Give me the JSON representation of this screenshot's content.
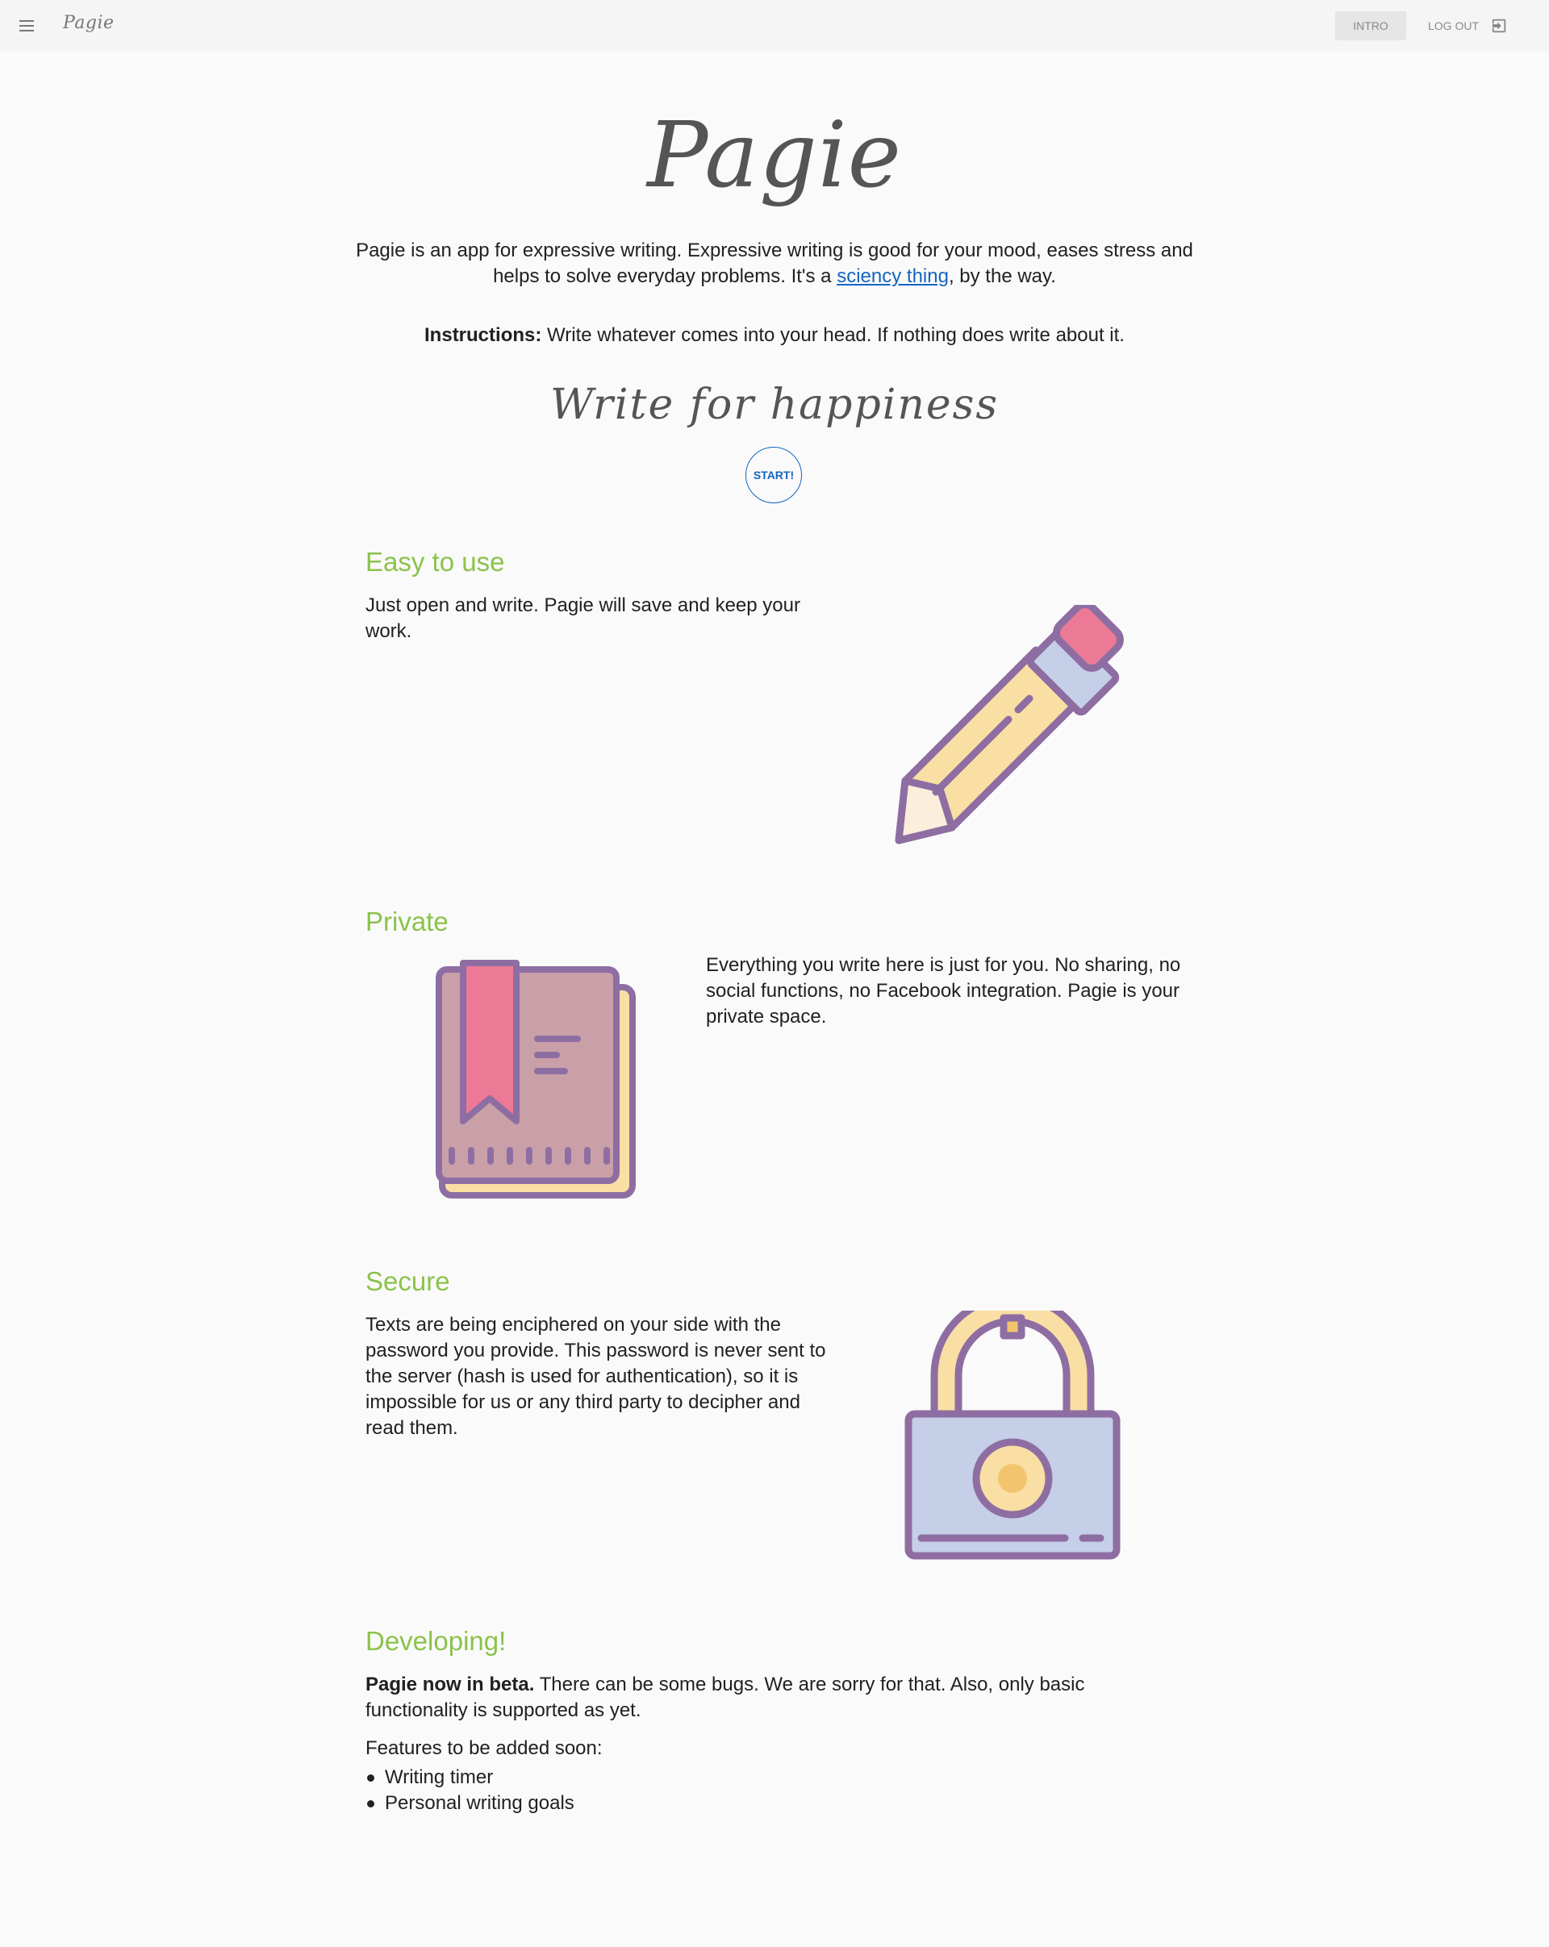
{
  "header": {
    "logo": "Pagie",
    "tabs": [
      {
        "label": "INTRO"
      }
    ],
    "logout_label": "LOG OUT"
  },
  "hero": {
    "logo": "Pagie",
    "intro_before_link": "Pagie is an app for expressive writing. Expressive writing is good for your mood, eases stress and helps to solve everyday problems. It's a ",
    "intro_link": "sciency thing",
    "intro_after_link": ", by the way.",
    "instructions_label": "Instructions:",
    "instructions_text": " Write whatever comes into your head. If nothing does write about it.",
    "tagline": "Write for happiness",
    "start_label": "START!"
  },
  "sections": [
    {
      "title": "Easy to use",
      "text": "Just open and write. Pagie will save and keep your work."
    },
    {
      "title": "Private",
      "text": "Everything you write here is just for you. No sharing, no social functions, no Facebook integration. Pagie is your private space."
    },
    {
      "title": "Secure",
      "text": "Texts are being enciphered on your side with the password you provide. This password is never sent to the server (hash is used for authentication), so it is impossible for us or any third party to decipher and read them."
    }
  ],
  "developing": {
    "title": "Developing!",
    "beta_label": "Pagie now in beta.",
    "beta_text": " There can be some bugs. We are sorry for that. Also, only basic functionality is supported as yet.",
    "features_label": "Features to be added soon:",
    "features": [
      "Writing timer",
      "Personal writing goals"
    ]
  },
  "colors": {
    "accent_green": "#8bc34a",
    "link_blue": "#1565c0",
    "icon_purple": "#8e6ea2",
    "icon_pink": "#ec7a97",
    "icon_yellow": "#f9dfa3",
    "icon_lavender": "#c5cfe8"
  },
  "icons": {
    "menu": "hamburger-menu-icon",
    "logout": "logout-icon",
    "easy": "pencil-icon",
    "private": "bookmark-book-icon",
    "secure": "padlock-icon"
  }
}
